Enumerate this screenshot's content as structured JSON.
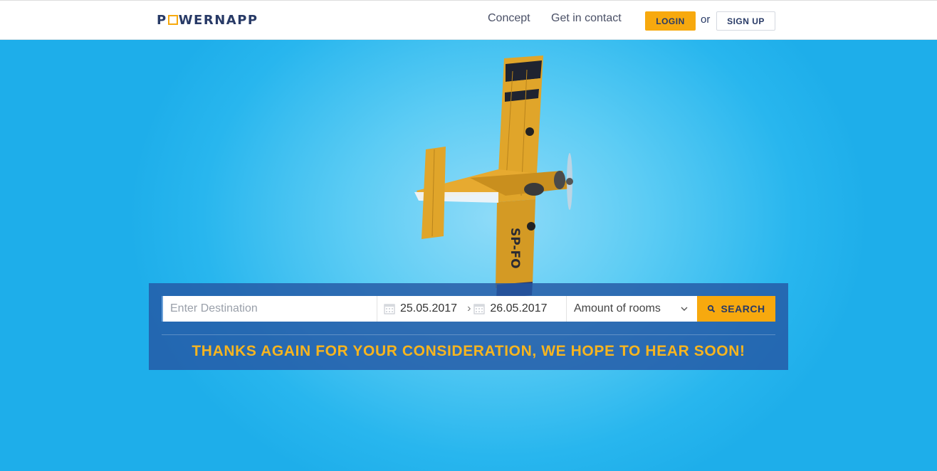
{
  "header": {
    "logo_text_pre": "P",
    "logo_text_post": "WERNAPP",
    "nav": {
      "concept": "Concept",
      "contact": "Get in contact"
    },
    "login_label": "LOGIN",
    "or_text": "or",
    "signup_label": "SIGN UP"
  },
  "search": {
    "destination_placeholder": "Enter Destination",
    "destination_value": "",
    "checkin_date": "25.05.2017",
    "checkout_date": "26.05.2017",
    "date_separator": "›",
    "rooms_selected": "Amount of rooms",
    "search_label": "SEARCH"
  },
  "message": "THANKS AGAIN FOR YOUR CONSIDERATION, WE HOPE TO HEAR SOON!",
  "colors": {
    "accent": "#f7a90e",
    "brand_navy": "#283a66",
    "panel_blue": "#2558a5",
    "sky": "#28b6ee"
  },
  "icons": {
    "calendar": "calendar-icon",
    "search": "search-icon",
    "dropdown": "chevron-down-icon"
  }
}
